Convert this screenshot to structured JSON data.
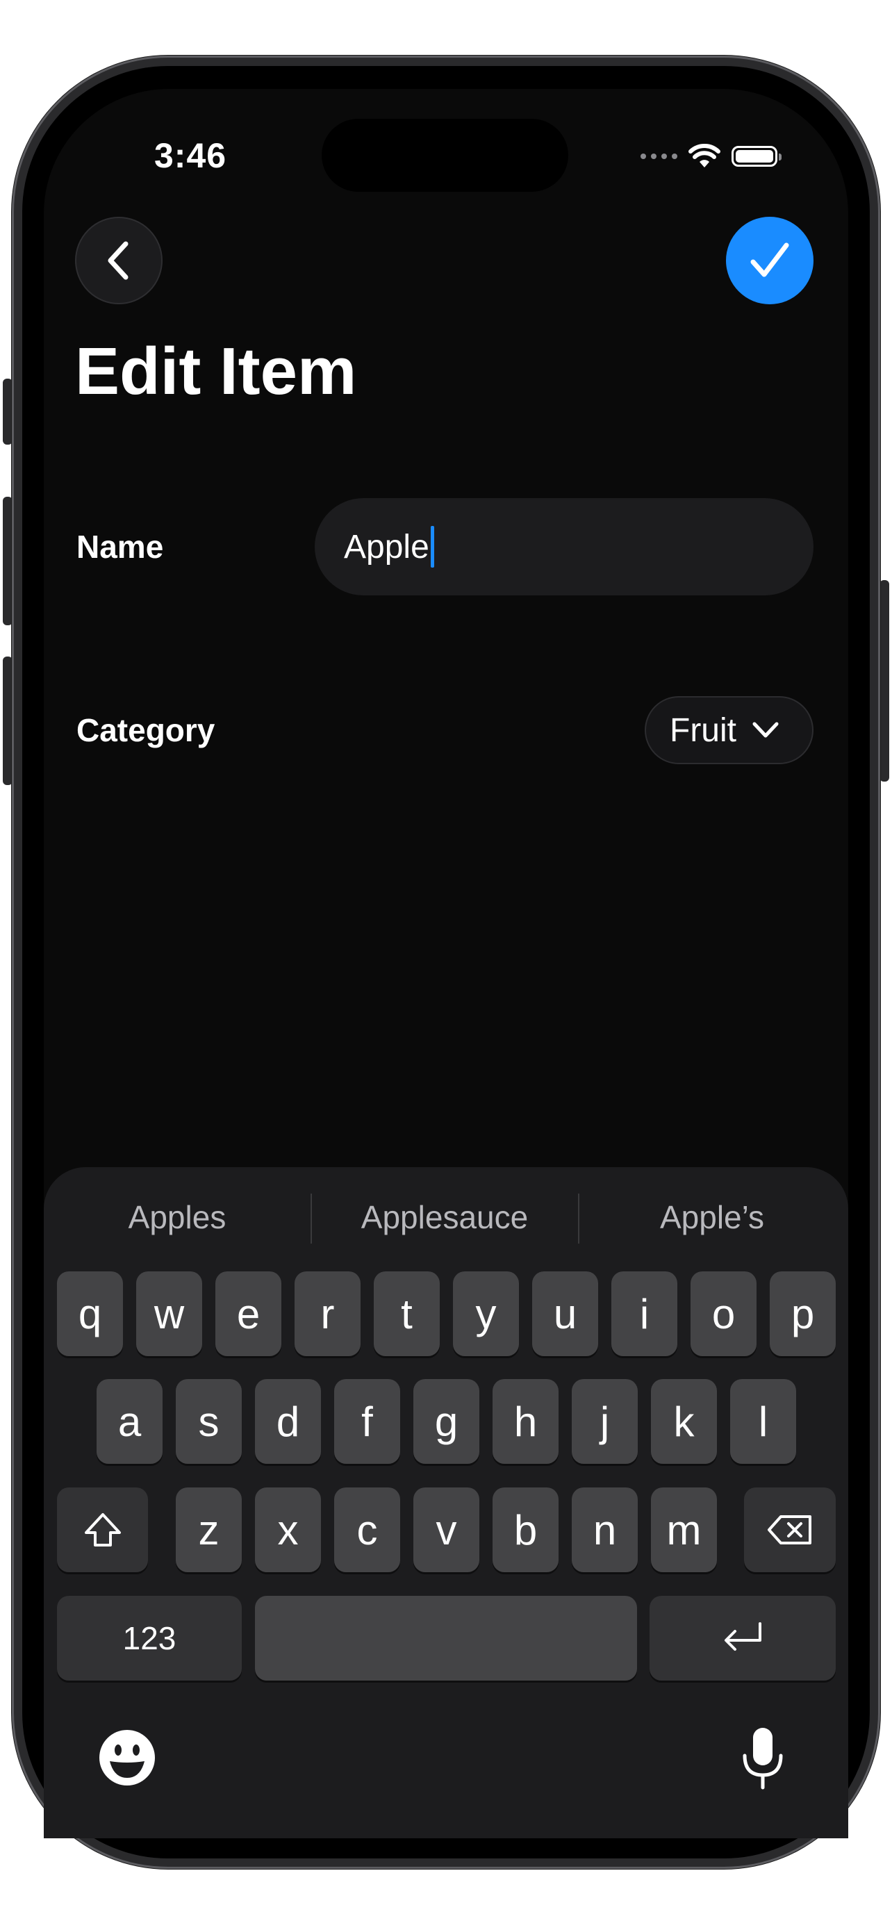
{
  "status_bar": {
    "time": "3:46"
  },
  "nav": {
    "back_icon": "chevron-left-icon",
    "done_icon": "checkmark-icon",
    "done_color": "#1a8cff"
  },
  "page": {
    "title": "Edit Item"
  },
  "form": {
    "name_label": "Name",
    "name_value": "Apple",
    "category_label": "Category",
    "category_value": "Fruit"
  },
  "keyboard": {
    "suggestions": [
      "Apples",
      "Applesauce",
      "Apple’s"
    ],
    "row1": [
      "q",
      "w",
      "e",
      "r",
      "t",
      "y",
      "u",
      "i",
      "o",
      "p"
    ],
    "row2": [
      "a",
      "s",
      "d",
      "f",
      "g",
      "h",
      "j",
      "k",
      "l"
    ],
    "row3": [
      "z",
      "x",
      "c",
      "v",
      "b",
      "n",
      "m"
    ],
    "numbers_key": "123",
    "icons": [
      "shift-icon",
      "delete-icon",
      "return-icon",
      "emoji-icon",
      "microphone-icon"
    ]
  }
}
